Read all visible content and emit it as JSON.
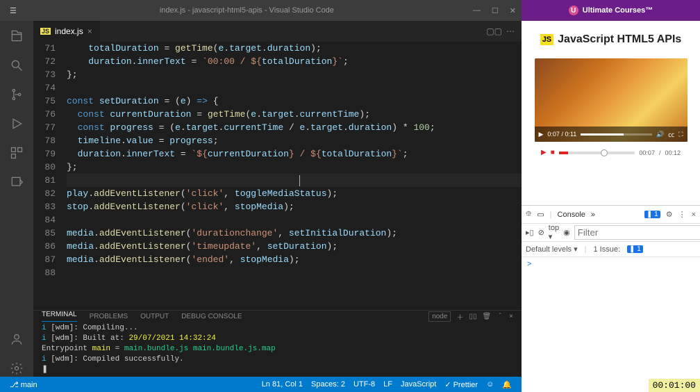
{
  "window": {
    "title": "index.js - javascript-html5-apis - Visual Studio Code",
    "menu_tooltip": "..."
  },
  "tab": {
    "filename": "index.js",
    "badge": "JS"
  },
  "code": [
    {
      "num": 71,
      "tokens": [
        [
          "    ",
          ""
        ],
        [
          "totalDuration",
          "var"
        ],
        [
          " = ",
          ""
        ],
        [
          "getTime",
          "fn"
        ],
        [
          "(",
          "paren"
        ],
        [
          "e",
          "var"
        ],
        [
          ".",
          ""
        ],
        [
          "target",
          "prop"
        ],
        [
          ".",
          ""
        ],
        [
          "duration",
          "prop"
        ],
        [
          ");",
          ""
        ]
      ]
    },
    {
      "num": 72,
      "tokens": [
        [
          "    ",
          ""
        ],
        [
          "duration",
          "var"
        ],
        [
          ".",
          ""
        ],
        [
          "innerText",
          "prop"
        ],
        [
          " = ",
          ""
        ],
        [
          "`00:00 / ",
          "str"
        ],
        [
          "${",
          "tmpl"
        ],
        [
          "totalDuration",
          "tmplvar"
        ],
        [
          "}",
          "tmpl"
        ],
        [
          "`",
          "str"
        ],
        [
          ";",
          ""
        ]
      ]
    },
    {
      "num": 73,
      "tokens": [
        [
          "};",
          ""
        ]
      ]
    },
    {
      "num": 74,
      "tokens": [
        [
          "",
          ""
        ]
      ]
    },
    {
      "num": 75,
      "tokens": [
        [
          "const ",
          "kw"
        ],
        [
          "setDuration",
          "var"
        ],
        [
          " = ",
          "op"
        ],
        [
          "(",
          ""
        ],
        [
          "e",
          "var"
        ],
        [
          ") ",
          ""
        ],
        [
          "=>",
          "kw"
        ],
        [
          " {",
          ""
        ]
      ]
    },
    {
      "num": 76,
      "tokens": [
        [
          "  ",
          ""
        ],
        [
          "const ",
          "kw"
        ],
        [
          "currentDuration",
          "var"
        ],
        [
          " = ",
          ""
        ],
        [
          "getTime",
          "fn"
        ],
        [
          "(",
          "paren"
        ],
        [
          "e",
          "var"
        ],
        [
          ".",
          ""
        ],
        [
          "target",
          "prop"
        ],
        [
          ".",
          ""
        ],
        [
          "currentTime",
          "prop"
        ],
        [
          ");",
          ""
        ]
      ]
    },
    {
      "num": 77,
      "tokens": [
        [
          "  ",
          ""
        ],
        [
          "const ",
          "kw"
        ],
        [
          "progress",
          "var"
        ],
        [
          " = (",
          "op"
        ],
        [
          "e",
          "var"
        ],
        [
          ".",
          ""
        ],
        [
          "target",
          "prop"
        ],
        [
          ".",
          ""
        ],
        [
          "currentTime",
          "prop"
        ],
        [
          " / ",
          "op"
        ],
        [
          "e",
          "var"
        ],
        [
          ".",
          ""
        ],
        [
          "target",
          "prop"
        ],
        [
          ".",
          ""
        ],
        [
          "duration",
          "prop"
        ],
        [
          ") * ",
          "op"
        ],
        [
          "100",
          "num"
        ],
        [
          ";",
          ""
        ]
      ]
    },
    {
      "num": 78,
      "tokens": [
        [
          "  ",
          ""
        ],
        [
          "timeline",
          "var"
        ],
        [
          ".",
          ""
        ],
        [
          "value",
          "prop"
        ],
        [
          " = ",
          ""
        ],
        [
          "progress",
          "var"
        ],
        [
          ";",
          ""
        ]
      ]
    },
    {
      "num": 79,
      "tokens": [
        [
          "  ",
          ""
        ],
        [
          "duration",
          "var"
        ],
        [
          ".",
          ""
        ],
        [
          "innerText",
          "prop"
        ],
        [
          " = ",
          ""
        ],
        [
          "`",
          "str"
        ],
        [
          "${",
          "tmpl"
        ],
        [
          "currentDuration",
          "tmplvar"
        ],
        [
          "}",
          "tmpl"
        ],
        [
          " / ",
          "str"
        ],
        [
          "${",
          "tmpl"
        ],
        [
          "totalDuration",
          "tmplvar"
        ],
        [
          "}",
          "tmpl"
        ],
        [
          "`",
          "str"
        ],
        [
          ";",
          ""
        ]
      ]
    },
    {
      "num": 80,
      "tokens": [
        [
          "};",
          ""
        ]
      ]
    },
    {
      "num": 81,
      "tokens": [
        [
          "",
          ""
        ]
      ],
      "current": true
    },
    {
      "num": 82,
      "tokens": [
        [
          "play",
          "var"
        ],
        [
          ".",
          ""
        ],
        [
          "addEventListener",
          "fn"
        ],
        [
          "(",
          ""
        ],
        [
          "'click'",
          "str"
        ],
        [
          ", ",
          ""
        ],
        [
          "toggleMediaStatus",
          "var"
        ],
        [
          ");",
          ""
        ]
      ]
    },
    {
      "num": 83,
      "tokens": [
        [
          "stop",
          "var"
        ],
        [
          ".",
          ""
        ],
        [
          "addEventListener",
          "fn"
        ],
        [
          "(",
          ""
        ],
        [
          "'click'",
          "str"
        ],
        [
          ", ",
          ""
        ],
        [
          "stopMedia",
          "var"
        ],
        [
          ");",
          ""
        ]
      ]
    },
    {
      "num": 84,
      "tokens": [
        [
          "",
          ""
        ]
      ]
    },
    {
      "num": 85,
      "tokens": [
        [
          "media",
          "var"
        ],
        [
          ".",
          ""
        ],
        [
          "addEventListener",
          "fn"
        ],
        [
          "(",
          ""
        ],
        [
          "'durationchange'",
          "str"
        ],
        [
          ", ",
          ""
        ],
        [
          "setInitialDuration",
          "var"
        ],
        [
          ");",
          ""
        ]
      ]
    },
    {
      "num": 86,
      "tokens": [
        [
          "media",
          "var"
        ],
        [
          ".",
          ""
        ],
        [
          "addEventListener",
          "fn"
        ],
        [
          "(",
          ""
        ],
        [
          "'timeupdate'",
          "str"
        ],
        [
          ", ",
          ""
        ],
        [
          "setDuration",
          "var"
        ],
        [
          ");",
          ""
        ]
      ]
    },
    {
      "num": 87,
      "tokens": [
        [
          "media",
          "var"
        ],
        [
          ".",
          ""
        ],
        [
          "addEventListener",
          "fn"
        ],
        [
          "(",
          ""
        ],
        [
          "'ended'",
          "str"
        ],
        [
          ", ",
          ""
        ],
        [
          "stopMedia",
          "var"
        ],
        [
          ");",
          ""
        ]
      ]
    },
    {
      "num": 88,
      "tokens": [
        [
          "",
          ""
        ]
      ]
    }
  ],
  "terminal": {
    "tabs": {
      "terminal": "TERMINAL",
      "problems": "PROBLEMS",
      "output": "OUTPUT",
      "debug": "DEBUG CONSOLE"
    },
    "shell": "node",
    "lines": [
      {
        "segments": [
          [
            "i ",
            "cyan"
          ],
          [
            "[wdm]",
            ""
          ],
          [
            ": Compiling...",
            ""
          ]
        ]
      },
      {
        "segments": [
          [
            "i ",
            "cyan"
          ],
          [
            "[wdm]",
            ""
          ],
          [
            ": Built at: ",
            ""
          ],
          [
            "29/07/2021 14:32:24",
            "yellow"
          ]
        ]
      },
      {
        "segments": [
          [
            "Entrypoint ",
            ""
          ],
          [
            "main",
            "yellow"
          ],
          [
            " = ",
            ""
          ],
          [
            "main.bundle.js main.bundle.js.map",
            "green"
          ]
        ]
      },
      {
        "segments": [
          [
            "i ",
            "cyan"
          ],
          [
            "[wdm]",
            ""
          ],
          [
            ": Compiled successfully.",
            ""
          ]
        ]
      },
      {
        "segments": [
          [
            "❚",
            ""
          ]
        ]
      }
    ]
  },
  "statusbar": {
    "branch": "main",
    "lncol": "Ln 81, Col 1",
    "spaces": "Spaces: 2",
    "encoding": "UTF-8",
    "eol": "LF",
    "language": "JavaScript",
    "prettier": "Prettier"
  },
  "rightpane": {
    "brand": "Ultimate Courses™",
    "page_title": "JavaScript HTML5 APIs",
    "js_badge": "JS",
    "video": {
      "play": "▶",
      "time": "0:07 / 0:11",
      "vol": "🔊",
      "cc": "㏄",
      "full": "⛶"
    },
    "ext": {
      "play": "▶",
      "stop": "■",
      "elapsed": "00:07",
      "total": "00:12"
    },
    "devtools": {
      "inspect": "⯐",
      "device": "▭",
      "console": "Console",
      "more": "»",
      "badge1": "1",
      "gear": "⚙",
      "kebab": "⋮",
      "close": "×",
      "row2": {
        "ban": "⊘",
        "clr": "⊘",
        "top": "top ▾",
        "eye": "◉",
        "filter_ph": "Filter",
        "gear2": "⚙"
      },
      "row3": {
        "levels": "Default levels ▾",
        "issues_label": "1 Issue:",
        "issues_badge": "1"
      },
      "prompt": ">"
    }
  },
  "overlay_timestamp": "00:01:00"
}
